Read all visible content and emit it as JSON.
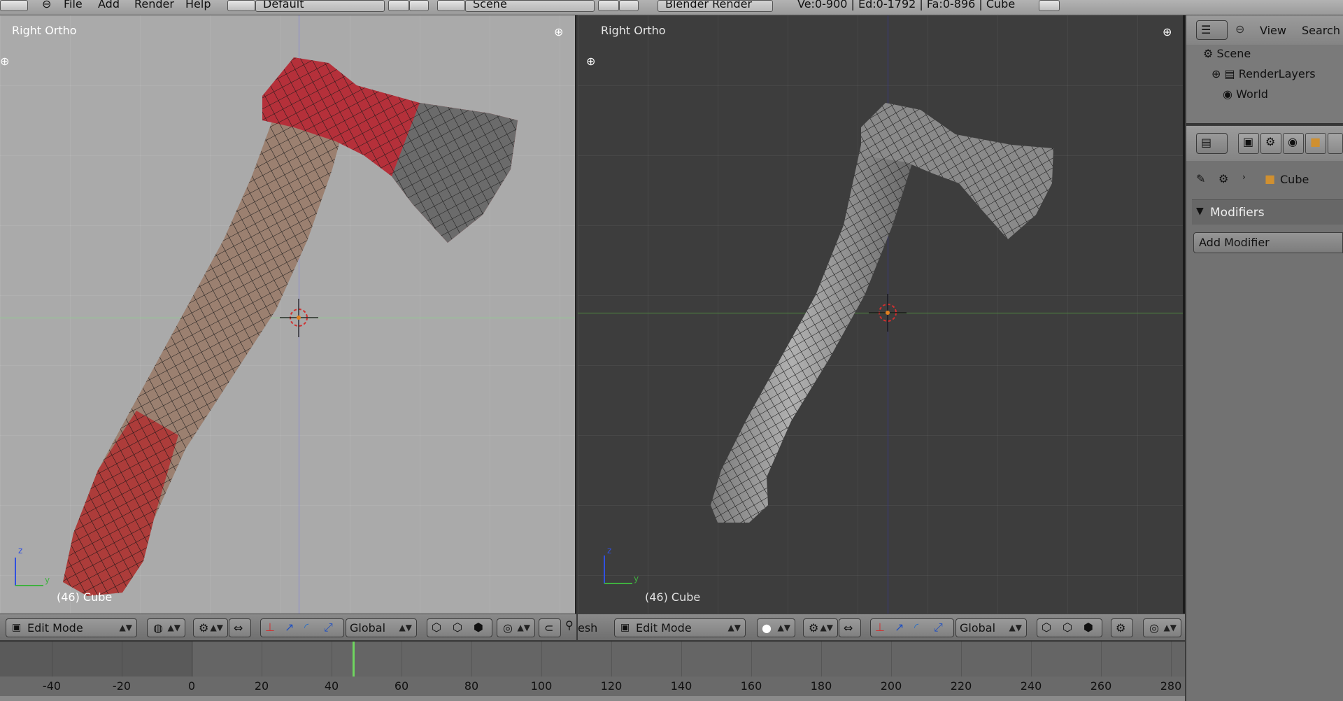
{
  "topbar": {
    "menu_file": "File",
    "menu_add": "Add",
    "menu_render": "Render",
    "menu_help": "Help",
    "screen_layout": "Default",
    "scene_name": "Scene",
    "render_engine": "Blender Render",
    "stats": "Ve:0-900 | Ed:0-1792 | Fa:0-896 | Cube"
  },
  "viewport_left": {
    "title": "Right Ortho",
    "object_label": "(46) Cube",
    "axis_z": "z",
    "axis_y": "y"
  },
  "viewport_right": {
    "title": "Right Ortho",
    "object_label": "(46) Cube",
    "axis_z": "z",
    "axis_y": "y"
  },
  "header_left": {
    "mode": "Edit Mode",
    "orientation": "Global"
  },
  "header_right": {
    "menu_mesh_partial": "esh",
    "mode": "Edit Mode",
    "orientation": "Global"
  },
  "timeline": {
    "current_frame": 46,
    "labels": [
      "-40",
      "-20",
      "0",
      "20",
      "40",
      "60",
      "80",
      "100",
      "120",
      "140",
      "160",
      "180",
      "200",
      "220",
      "240",
      "260",
      "280"
    ]
  },
  "outliner": {
    "menu_view": "View",
    "menu_search": "Search",
    "items": [
      {
        "label": "Scene",
        "icon": "scene-icon"
      },
      {
        "label": "RenderLayers",
        "icon": "renderlayers-icon"
      },
      {
        "label": "World",
        "icon": "world-icon"
      }
    ]
  },
  "properties": {
    "breadcrumb_object": "Cube",
    "panel_title": "Modifiers",
    "add_modifier_label": "Add Modifier"
  },
  "colors": {
    "vp_left_bg": "#aaaaaa",
    "vp_right_bg": "#3d3d3d",
    "x_axis_green": "#6aa84f",
    "z_axis_blue": "#4a4aa0",
    "selected_face_red": "#b02a2a",
    "frame_marker_green": "#6fd55f"
  }
}
